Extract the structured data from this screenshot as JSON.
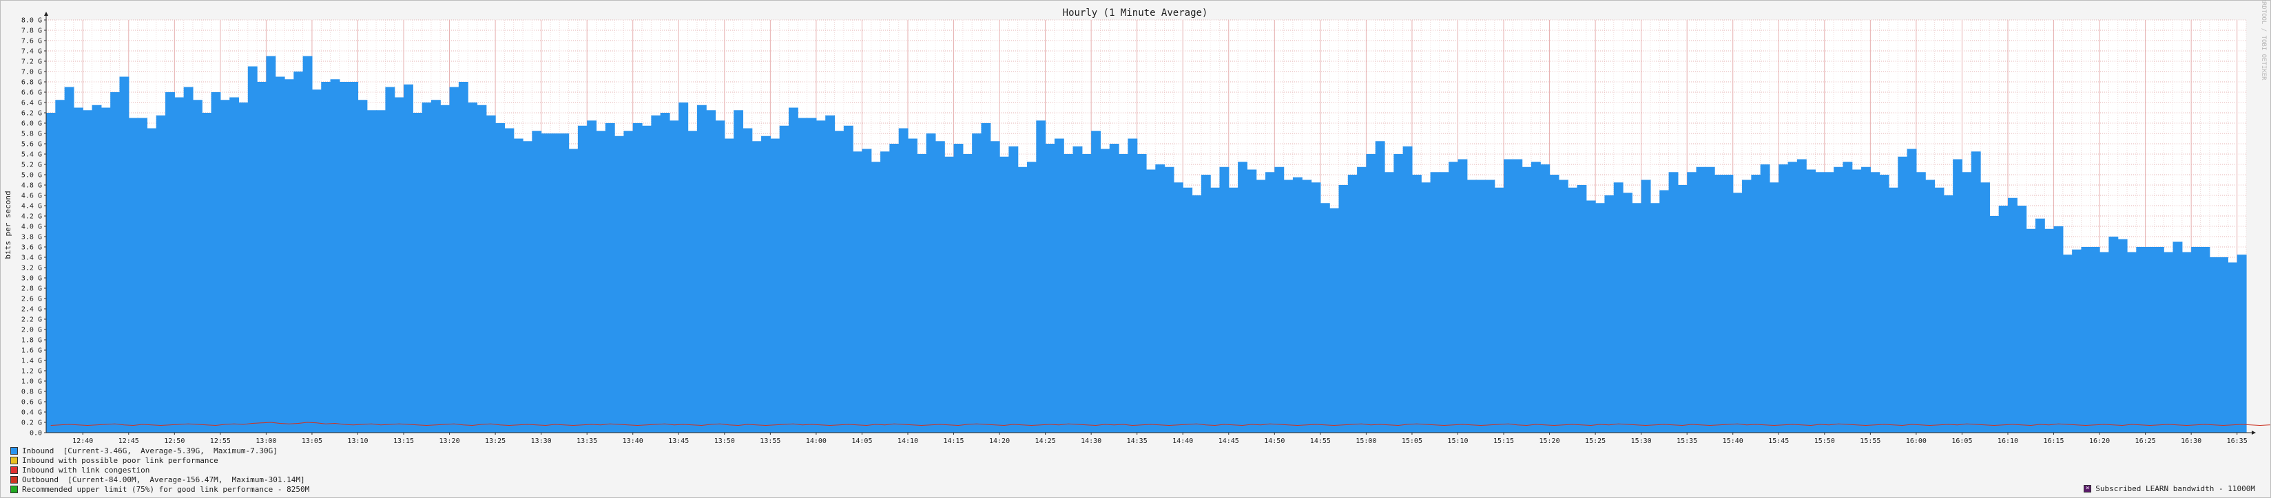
{
  "chart_data": {
    "type": "bar",
    "title": "Hourly (1 Minute Average)",
    "ylabel": "bits per second",
    "ylim": [
      0,
      8.0
    ],
    "y_unit": "G",
    "y_ticks": [
      "0.0",
      "0.2 G",
      "0.4 G",
      "0.6 G",
      "0.8 G",
      "1.0 G",
      "1.2 G",
      "1.4 G",
      "1.6 G",
      "1.8 G",
      "2.0 G",
      "2.2 G",
      "2.4 G",
      "2.6 G",
      "2.8 G",
      "3.0 G",
      "3.2 G",
      "3.4 G",
      "3.6 G",
      "3.8 G",
      "4.0 G",
      "4.2 G",
      "4.4 G",
      "4.6 G",
      "4.8 G",
      "5.0 G",
      "5.2 G",
      "5.4 G",
      "5.6 G",
      "5.8 G",
      "6.0 G",
      "6.2 G",
      "6.4 G",
      "6.6 G",
      "6.8 G",
      "7.0 G",
      "7.2 G",
      "7.4 G",
      "7.6 G",
      "7.8 G",
      "8.0 G"
    ],
    "x_ticks": [
      "12:40",
      "12:45",
      "12:50",
      "12:55",
      "13:00",
      "13:05",
      "13:10",
      "13:15",
      "13:20",
      "13:25",
      "13:30",
      "13:35",
      "13:40",
      "13:45",
      "13:50",
      "13:55",
      "14:00",
      "14:05",
      "14:10",
      "14:15",
      "14:20",
      "14:25",
      "14:30",
      "14:35",
      "14:40",
      "14:45",
      "14:50",
      "14:55",
      "15:00",
      "15:05",
      "15:10",
      "15:15",
      "15:20",
      "15:25",
      "15:30",
      "15:35",
      "15:40",
      "15:45",
      "15:50",
      "15:55",
      "16:00",
      "16:05",
      "16:10",
      "16:15",
      "16:20",
      "16:25",
      "16:30",
      "16:35"
    ],
    "x_start": "12:36",
    "x_end": "16:36",
    "interval_minutes": 1,
    "grid": true,
    "series": [
      {
        "name": "Inbound",
        "color": "#2a94ee",
        "values": [
          6.2,
          6.45,
          6.7,
          6.3,
          6.25,
          6.35,
          6.3,
          6.6,
          6.9,
          6.1,
          6.1,
          5.9,
          6.15,
          6.6,
          6.5,
          6.7,
          6.45,
          6.2,
          6.6,
          6.45,
          6.5,
          6.4,
          7.1,
          6.8,
          7.3,
          6.9,
          6.85,
          7.0,
          7.3,
          6.65,
          6.8,
          6.85,
          6.8,
          6.8,
          6.45,
          6.25,
          6.25,
          6.7,
          6.5,
          6.75,
          6.2,
          6.4,
          6.45,
          6.35,
          6.7,
          6.8,
          6.4,
          6.35,
          6.15,
          6.0,
          5.9,
          5.7,
          5.65,
          5.85,
          5.8,
          5.8,
          5.8,
          5.5,
          5.95,
          6.05,
          5.85,
          6.0,
          5.75,
          5.85,
          6.0,
          5.95,
          6.15,
          6.2,
          6.05,
          6.4,
          5.85,
          6.35,
          6.25,
          6.05,
          5.7,
          6.25,
          5.9,
          5.65,
          5.75,
          5.7,
          5.95,
          6.3,
          6.1,
          6.1,
          6.05,
          6.15,
          5.85,
          5.95,
          5.45,
          5.5,
          5.25,
          5.45,
          5.6,
          5.9,
          5.7,
          5.4,
          5.8,
          5.65,
          5.35,
          5.6,
          5.4,
          5.8,
          6.0,
          5.65,
          5.35,
          5.55,
          5.15,
          5.25,
          6.05,
          5.6,
          5.7,
          5.4,
          5.55,
          5.4,
          5.85,
          5.5,
          5.6,
          5.4,
          5.7,
          5.4,
          5.1,
          5.2,
          5.15,
          4.85,
          4.75,
          4.6,
          5.0,
          4.75,
          5.15,
          4.75,
          5.25,
          5.1,
          4.9,
          5.05,
          5.15,
          4.9,
          4.95,
          4.9,
          4.85,
          4.45,
          4.35,
          4.8,
          5.0,
          5.15,
          5.4,
          5.65,
          5.05,
          5.4,
          5.55,
          5.0,
          4.85,
          5.05,
          5.05,
          5.25,
          5.3,
          4.9,
          4.9,
          4.9,
          4.75,
          5.3,
          5.3,
          5.15,
          5.25,
          5.2,
          5.0,
          4.9,
          4.75,
          4.8,
          4.5,
          4.45,
          4.6,
          4.85,
          4.65,
          4.45,
          4.9,
          4.45,
          4.7,
          5.05,
          4.8,
          5.05,
          5.15,
          5.15,
          5.0,
          5.0,
          4.65,
          4.9,
          5.0,
          5.2,
          4.85,
          5.2,
          5.25,
          5.3,
          5.1,
          5.05,
          5.05,
          5.15,
          5.25,
          5.1,
          5.15,
          5.05,
          5.0,
          4.75,
          5.35,
          5.5,
          5.05,
          4.9,
          4.75,
          4.6,
          5.3,
          5.05,
          5.45,
          4.85,
          4.2,
          4.4,
          4.55,
          4.4,
          3.95,
          4.15,
          3.95,
          4.0,
          3.45,
          3.55,
          3.6,
          3.6,
          3.5,
          3.8,
          3.75,
          3.5,
          3.6,
          3.6,
          3.6,
          3.5,
          3.7,
          3.5,
          3.6,
          3.6,
          3.4,
          3.4,
          3.3,
          3.45
        ]
      },
      {
        "name": "Outbound",
        "color": "#cc3322",
        "values": [
          0.14,
          0.15,
          0.16,
          0.15,
          0.14,
          0.15,
          0.16,
          0.17,
          0.15,
          0.14,
          0.16,
          0.15,
          0.14,
          0.15,
          0.16,
          0.17,
          0.16,
          0.15,
          0.14,
          0.16,
          0.17,
          0.16,
          0.18,
          0.19,
          0.2,
          0.18,
          0.17,
          0.18,
          0.2,
          0.19,
          0.17,
          0.18,
          0.16,
          0.15,
          0.16,
          0.17,
          0.15,
          0.16,
          0.17,
          0.16,
          0.15,
          0.14,
          0.15,
          0.16,
          0.17,
          0.15,
          0.14,
          0.16,
          0.17,
          0.15,
          0.14,
          0.15,
          0.16,
          0.15,
          0.14,
          0.16,
          0.15,
          0.14,
          0.15,
          0.16,
          0.15,
          0.17,
          0.16,
          0.15,
          0.14,
          0.15,
          0.16,
          0.17,
          0.15,
          0.16,
          0.15,
          0.14,
          0.16,
          0.17,
          0.15,
          0.14,
          0.16,
          0.15,
          0.14,
          0.15,
          0.16,
          0.17,
          0.15,
          0.16,
          0.15,
          0.14,
          0.15,
          0.16,
          0.15,
          0.14,
          0.16,
          0.15,
          0.17,
          0.16,
          0.15,
          0.14,
          0.15,
          0.16,
          0.15,
          0.14,
          0.16,
          0.17,
          0.16,
          0.15,
          0.14,
          0.16,
          0.15,
          0.14,
          0.15,
          0.16,
          0.15,
          0.17,
          0.16,
          0.15,
          0.14,
          0.16,
          0.15,
          0.16,
          0.14,
          0.15,
          0.16,
          0.15,
          0.14,
          0.15,
          0.16,
          0.17,
          0.15,
          0.14,
          0.16,
          0.15,
          0.14,
          0.16,
          0.15,
          0.17,
          0.16,
          0.15,
          0.14,
          0.15,
          0.16,
          0.15,
          0.14,
          0.15,
          0.16,
          0.17,
          0.15,
          0.16,
          0.15,
          0.14,
          0.16,
          0.17,
          0.16,
          0.15,
          0.14,
          0.15,
          0.16,
          0.15,
          0.14,
          0.15,
          0.16,
          0.17,
          0.15,
          0.14,
          0.16,
          0.15,
          0.14,
          0.15,
          0.16,
          0.15,
          0.14,
          0.16,
          0.15,
          0.17,
          0.16,
          0.15,
          0.14,
          0.15,
          0.16,
          0.15,
          0.14,
          0.16,
          0.15,
          0.14,
          0.15,
          0.16,
          0.17,
          0.15,
          0.16,
          0.15,
          0.14,
          0.15,
          0.16,
          0.15,
          0.14,
          0.16,
          0.15,
          0.17,
          0.16,
          0.15,
          0.14,
          0.15,
          0.16,
          0.15,
          0.14,
          0.16,
          0.15,
          0.14,
          0.15,
          0.16,
          0.15,
          0.17,
          0.16,
          0.15,
          0.14,
          0.15,
          0.16,
          0.15,
          0.14,
          0.16,
          0.15,
          0.17,
          0.16,
          0.15,
          0.14,
          0.15,
          0.16,
          0.15,
          0.14,
          0.16,
          0.15,
          0.14,
          0.15,
          0.16,
          0.15,
          0.14,
          0.15,
          0.16,
          0.15,
          0.14,
          0.15,
          0.16,
          0.15,
          0.14,
          0.15,
          0.16,
          0.15,
          0.14,
          0.15
        ]
      }
    ]
  },
  "watermark": "RRDTOOL / TOBI OETIKER",
  "legend": [
    {
      "id": "inbound",
      "color": "#2a94ee",
      "text": "Inbound  [Current-3.46G,  Average-5.39G,  Maximum-7.30G]"
    },
    {
      "id": "inbound-poor",
      "color": "#e8c020",
      "text": "Inbound with possible poor link performance"
    },
    {
      "id": "inbound-congestion",
      "color": "#e03030",
      "text": "Inbound with link congestion"
    },
    {
      "id": "outbound",
      "color": "#cc3322",
      "text": "Outbound  [Current-84.00M,  Average-156.47M,  Maximum-301.14M]"
    },
    {
      "id": "recommended",
      "color": "#22aa22",
      "text": "Recommended upper limit (75%) for good link performance - 8250M"
    }
  ],
  "legend_right": {
    "color": "#5a1a6a",
    "text": "Subscribed LEARN bandwidth - 11000M"
  }
}
